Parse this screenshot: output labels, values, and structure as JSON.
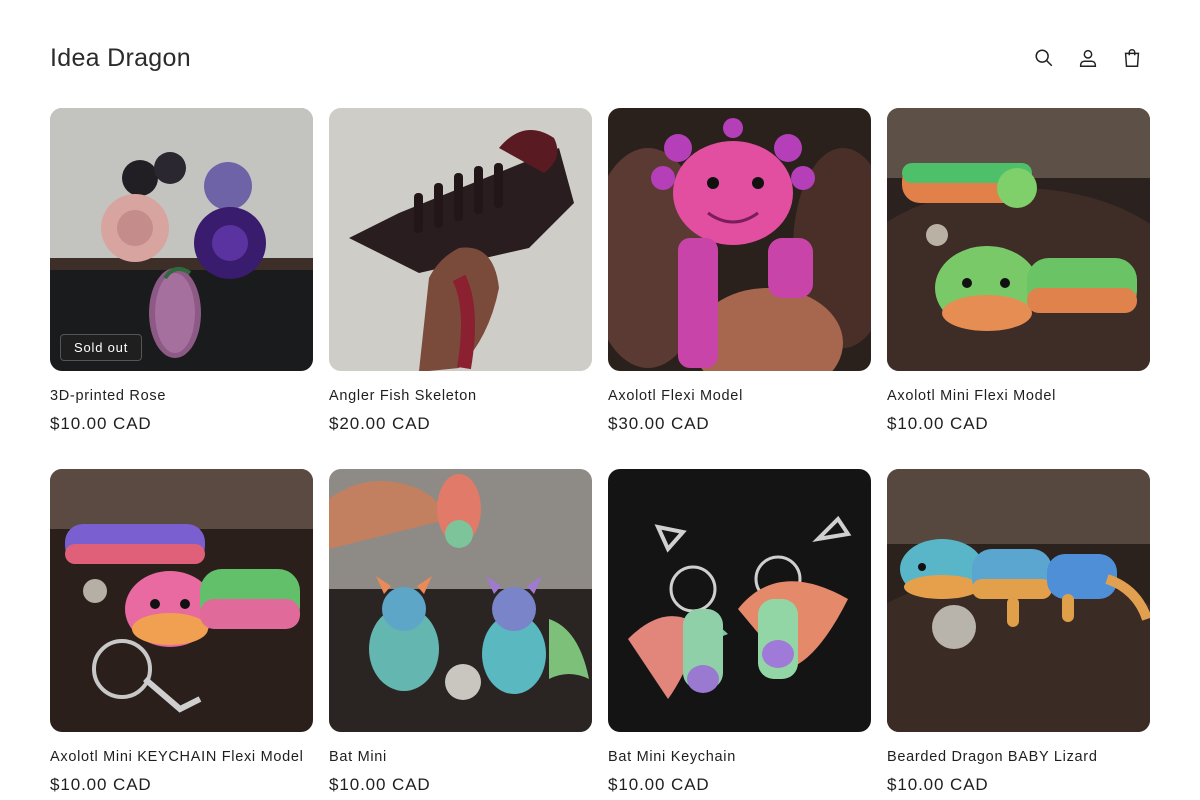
{
  "header": {
    "brand": "Idea Dragon",
    "icons": [
      "search-icon",
      "account-icon",
      "cart-icon"
    ]
  },
  "products": [
    {
      "title": "3D-printed Rose",
      "price": "$10.00 CAD",
      "badge": "Sold out"
    },
    {
      "title": "Angler Fish Skeleton",
      "price": "$20.00 CAD"
    },
    {
      "title": "Axolotl Flexi Model",
      "price": "$30.00 CAD"
    },
    {
      "title": "Axolotl Mini Flexi Model",
      "price": "$10.00 CAD"
    },
    {
      "title": "Axolotl Mini KEYCHAIN Flexi Model",
      "price": "$10.00 CAD"
    },
    {
      "title": "Bat Mini",
      "price": "$10.00 CAD"
    },
    {
      "title": "Bat Mini Keychain",
      "price": "$10.00 CAD"
    },
    {
      "title": "Bearded Dragon BABY Lizard",
      "price": "$10.00 CAD"
    }
  ],
  "colors": {
    "text": "#121212",
    "badge_bg": "#1f1f1f"
  }
}
